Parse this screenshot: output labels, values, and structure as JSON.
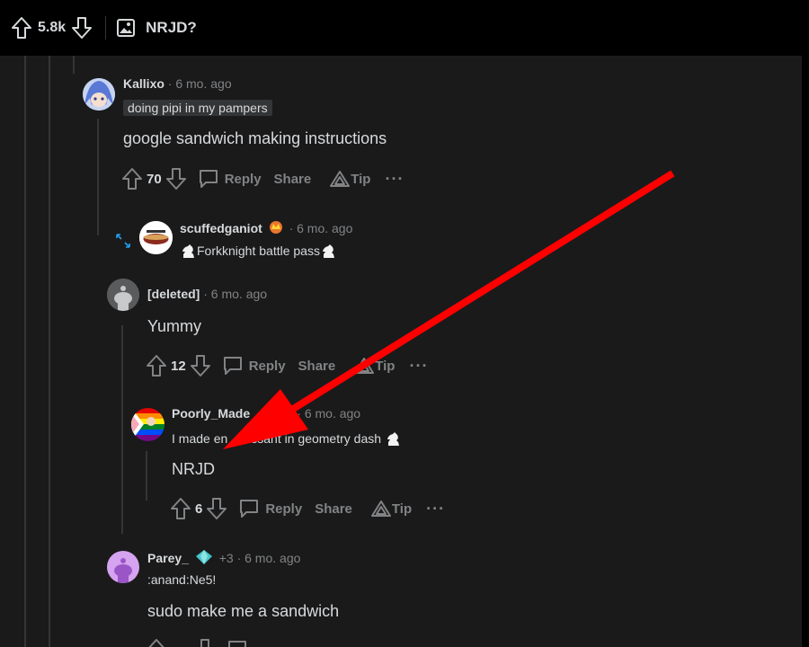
{
  "post": {
    "score": "5.8k",
    "title": "NRJD?"
  },
  "actions": {
    "reply": "Reply",
    "share": "Share",
    "tip": "Tip",
    "more": "···"
  },
  "comments": [
    {
      "author": "Kallixo",
      "time": "· 6 mo. ago",
      "flair": "doing pipi in my pampers",
      "body": "google sandwich making instructions",
      "score": "70"
    },
    {
      "author": "scuffedganiot",
      "time": "· 6 mo. ago",
      "flair": "Forkknight battle pass"
    },
    {
      "author": "[deleted]",
      "time": "· 6 mo. ago",
      "body": "Yummy",
      "score": "12"
    },
    {
      "author": "Poorly_Made",
      "author_tail": "nix",
      "time": "· 6 mo. ago",
      "flair": "I made en",
      "flair_tail": "ssant in geometry dash",
      "body": "NRJD",
      "score": "6"
    },
    {
      "author": "Parey_",
      "award_count": "+3",
      "time": "· 6 mo. ago",
      "flair": ":anand:Ne5!",
      "body": "sudo make me a sandwich"
    }
  ],
  "colors": {
    "annotation_arrow": "#ff0000",
    "background": "#1a1a1b",
    "text": "#d7dadc",
    "muted": "#818384"
  }
}
